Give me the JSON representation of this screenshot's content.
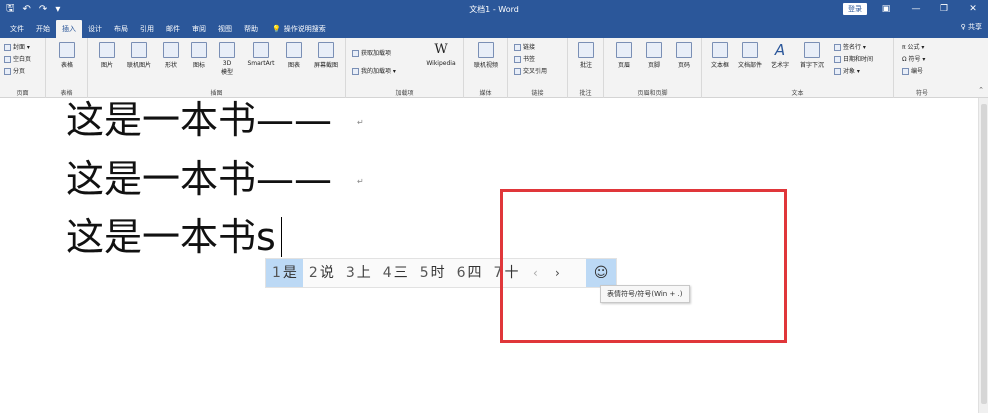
{
  "titlebar": {
    "qat": {
      "save": "🖫",
      "undo": "↶",
      "redo": "↷",
      "customize": "▾"
    },
    "title": "文档1  -  Word",
    "signin": "登录",
    "layout_icon": "▣",
    "minimize": "—",
    "restore": "❐",
    "close": "✕"
  },
  "tabs": [
    "文件",
    "开始",
    "插入",
    "设计",
    "布局",
    "引用",
    "邮件",
    "审阅",
    "视图",
    "帮助"
  ],
  "active_tab": "插入",
  "tellme": {
    "icon": "💡",
    "label": "操作说明搜索"
  },
  "share": "♀ 共享",
  "ribbon": {
    "pages": {
      "cover": "封面 ▾",
      "blank": "空白页",
      "break": "分页",
      "label": "页面"
    },
    "tables": {
      "table": "表格",
      "label": "表格"
    },
    "illustrations": {
      "picture": "图片",
      "online_picture": "联机图片",
      "shapes": "形状",
      "icons": "图标",
      "3d": "3D\n模型",
      "smartart": "SmartArt",
      "chart": "图表",
      "screenshot": "屏幕截图",
      "label": "插图"
    },
    "addins": {
      "get": "获取加载项",
      "my": "我的加载项 ▾",
      "wikipedia": "Wikipedia",
      "label": "加载项"
    },
    "media": {
      "online_video": "联机视频",
      "label": "媒体"
    },
    "links": {
      "link": "链接",
      "bookmark": "书签",
      "crossref": "交叉引用",
      "label": "链接"
    },
    "comments": {
      "comment": "批注",
      "label": "批注"
    },
    "header_footer": {
      "header": "页眉",
      "footer": "页脚",
      "page_number": "页码",
      "label": "页眉和页脚"
    },
    "text": {
      "textbox": "文本框",
      "quickparts": "文档部件",
      "wordart": "艺术字",
      "dropcap": "首字下沉",
      "signature": "签名行 ▾",
      "datetime": "日期和时间",
      "object": "对象 ▾",
      "label": "文本"
    },
    "symbols": {
      "equation": "π 公式 ▾",
      "symbol": "Ω 符号 ▾",
      "number": "编号",
      "label": "符号"
    }
  },
  "document": {
    "lines": [
      "这是一本书——",
      "这是一本书——",
      "这是一本书s"
    ],
    "para_mark": "↵"
  },
  "ime": {
    "candidates": [
      {
        "num": "1",
        "text": "是"
      },
      {
        "num": "2",
        "text": "说"
      },
      {
        "num": "3",
        "text": "上"
      },
      {
        "num": "4",
        "text": "三"
      },
      {
        "num": "5",
        "text": "时"
      },
      {
        "num": "6",
        "text": "四"
      },
      {
        "num": "7",
        "text": "十"
      }
    ],
    "prev": "‹",
    "next": "›",
    "emoji": "☺",
    "tooltip": "表情符号/符号(Win + .)"
  },
  "colors": {
    "accent": "#2b579a",
    "highlight": "#e0363a",
    "candidate_selected": "#bcd9f5"
  }
}
